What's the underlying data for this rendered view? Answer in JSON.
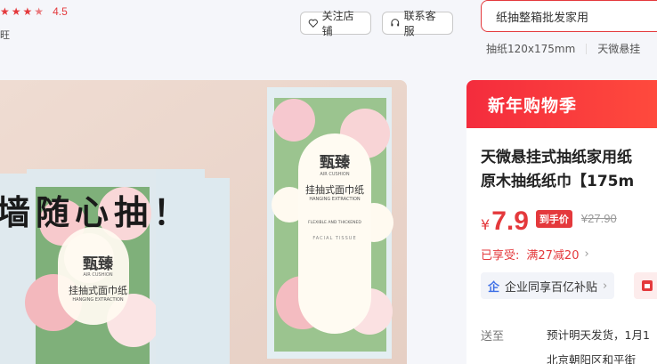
{
  "shop": {
    "rating": "4.5",
    "tag_partial": "旺"
  },
  "buttons": {
    "follow": "关注店铺",
    "service": "联系客服"
  },
  "search": {
    "value": "纸抽整箱批发家用"
  },
  "hot_searches": [
    "抽纸120x175mm",
    "天微悬挂"
  ],
  "gallery": {
    "slogan": "墙随心抽！",
    "package": {
      "brand": "甄臻",
      "brand_en": "AIR CUSHION",
      "name": "挂抽式面巾纸",
      "name_en": "HANGING EXTRACTION",
      "feature_en": "FLEXIBLE AND THICKENED",
      "arc_en": "FACIAL TISSUE"
    }
  },
  "panel": {
    "header": "新年购物季",
    "title_line1": "天微悬挂式抽纸家用纸",
    "title_line2": "原木抽纸纸巾【175m",
    "currency": "¥",
    "price": "7.9",
    "price_badge": "到手价",
    "original_price": "¥27.90",
    "promo_label": "已享受:",
    "promo_value": "满27减20",
    "subsidy": "企业同享百亿补贴",
    "ship_label": "送至",
    "ship_text": "预计明天发货，1月1",
    "address": "北京朝阳区和平街"
  },
  "colors": {
    "accent": "#e4393c",
    "page_bg": "#f5f6fa"
  }
}
